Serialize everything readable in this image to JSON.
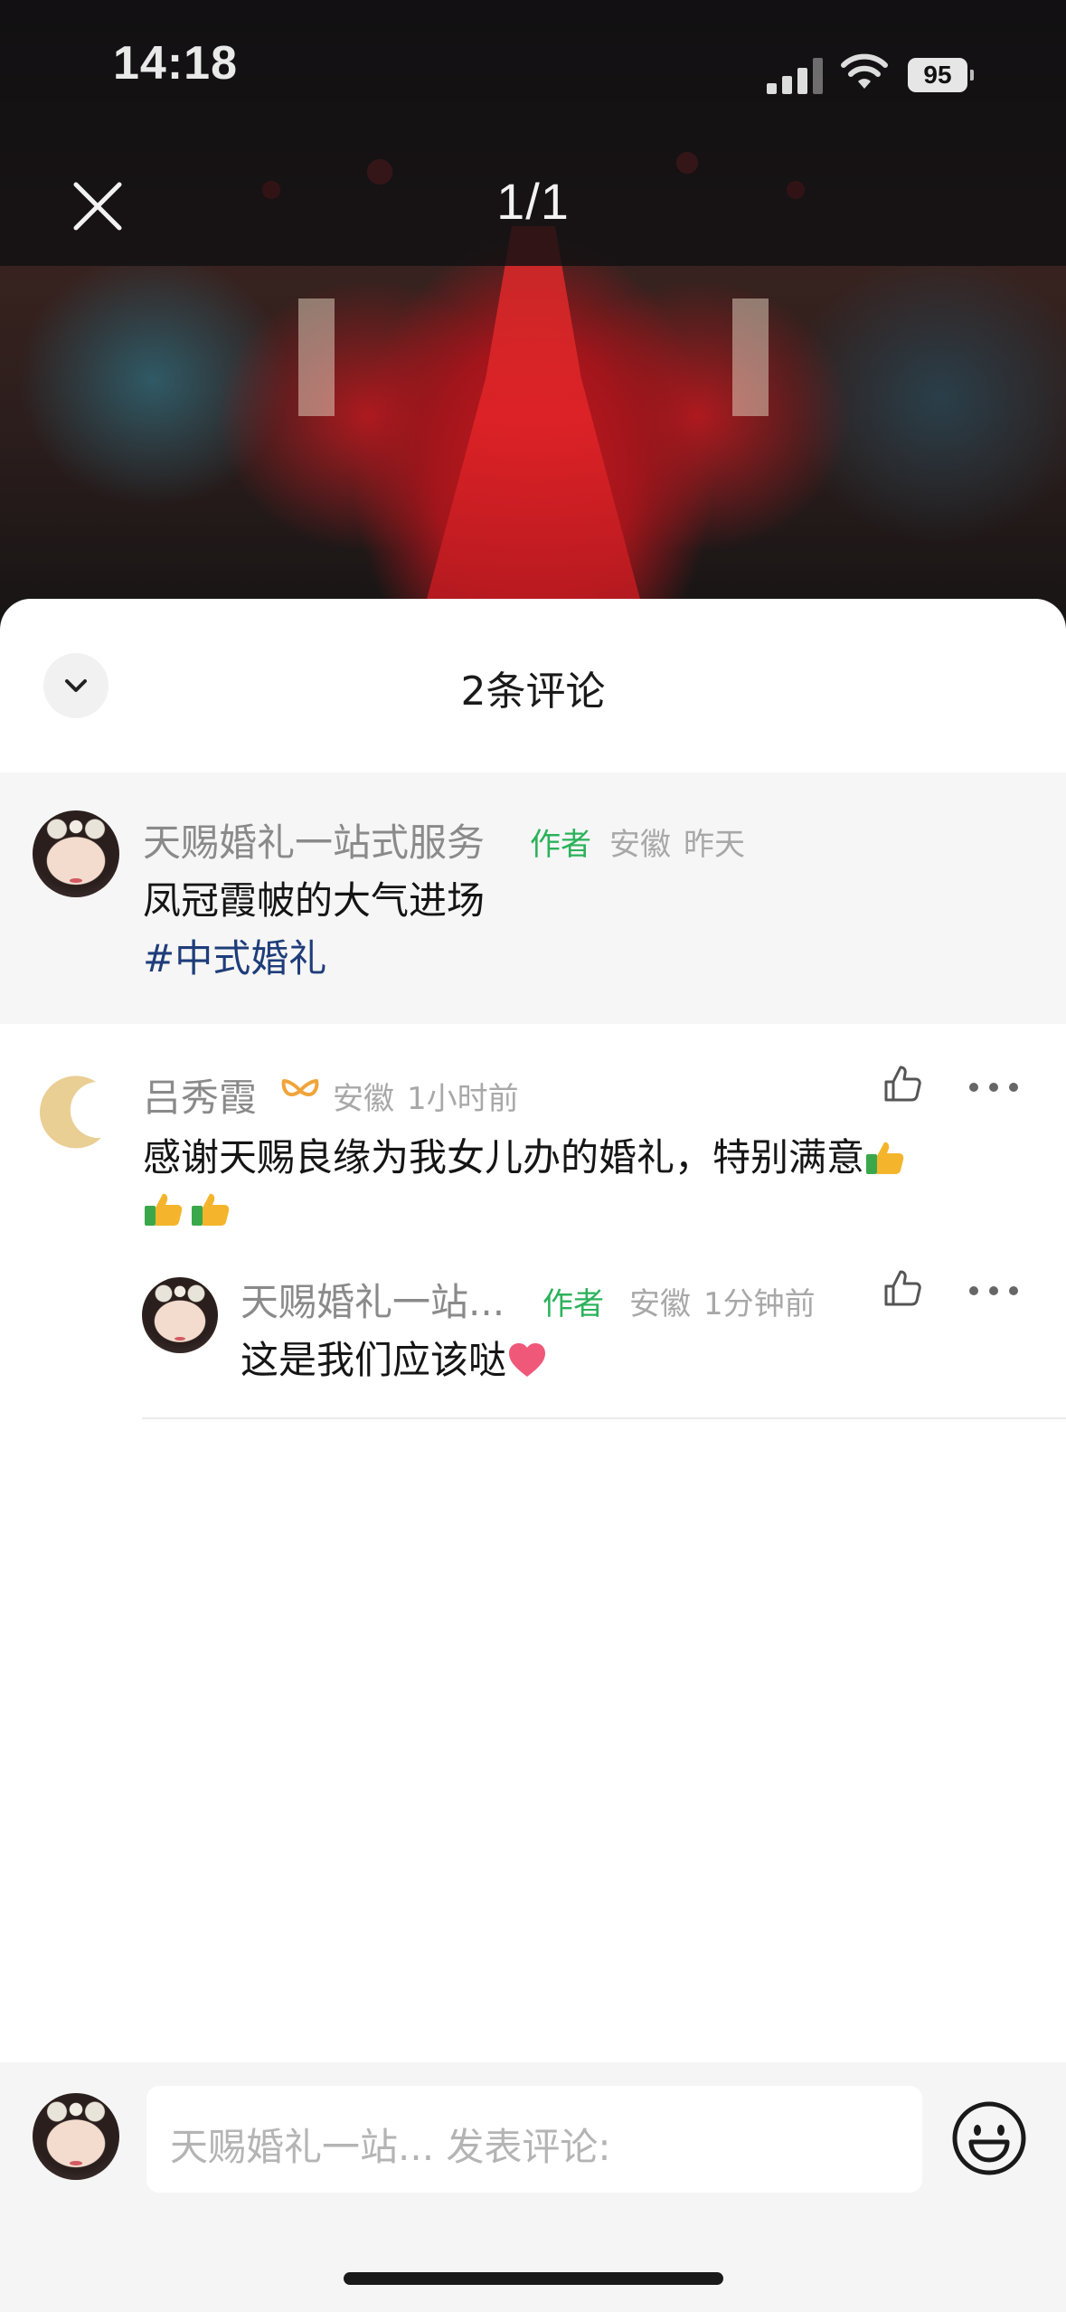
{
  "status_bar": {
    "time": "14:18",
    "battery": "95"
  },
  "viewer": {
    "counter": "1/1"
  },
  "comments_sheet": {
    "title": "2条评论",
    "pinned": {
      "user": "天赐婚礼一站式服务",
      "author_tag": "作者",
      "location": "安徽",
      "time": "昨天",
      "text": "凤冠霞帔的大气进场",
      "hashtag": "#中式婚礼"
    },
    "comments": [
      {
        "user": "吕秀霞",
        "location": "安徽",
        "time": "1小时前",
        "text_line1": "感谢天赐良缘为我女儿办的婚礼，特别满意",
        "replies": [
          {
            "user": "天赐婚礼一站...",
            "author_tag": "作者",
            "location": "安徽",
            "time": "1分钟前",
            "text": "这是我们应该哒"
          }
        ]
      }
    ]
  },
  "input": {
    "placeholder": "天赐婚礼一站... 发表评论:"
  },
  "icons": {
    "close": "close-icon",
    "collapse": "chevron-down-icon",
    "like": "thumb-up-icon",
    "more": "more-icon",
    "emoji": "smiley-icon"
  },
  "colors": {
    "author_tag": "#2bb25a",
    "hashtag": "#1f3d7a",
    "sheet_background": "#ffffff",
    "pinned_background": "#f6f6f6"
  }
}
